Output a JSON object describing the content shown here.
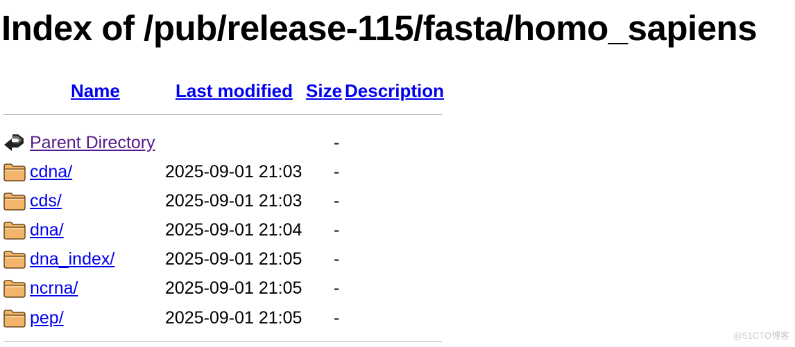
{
  "page": {
    "title": "Index of /pub/release-115/fasta/homo_sapiens"
  },
  "table": {
    "headers": {
      "name": "Name",
      "last_modified": "Last modified",
      "size": "Size",
      "description": "Description"
    },
    "parent": {
      "name": "Parent Directory",
      "size": "-",
      "icon": "back-arrow-icon"
    },
    "rows": [
      {
        "name": "cdna/",
        "last_modified": "2025-09-01 21:03",
        "size": "-",
        "icon": "folder-icon"
      },
      {
        "name": "cds/",
        "last_modified": "2025-09-01 21:03",
        "size": "-",
        "icon": "folder-icon"
      },
      {
        "name": "dna/",
        "last_modified": "2025-09-01 21:04",
        "size": "-",
        "icon": "folder-icon"
      },
      {
        "name": "dna_index/",
        "last_modified": "2025-09-01 21:05",
        "size": "-",
        "icon": "folder-icon"
      },
      {
        "name": "ncrna/",
        "last_modified": "2025-09-01 21:05",
        "size": "-",
        "icon": "folder-icon"
      },
      {
        "name": "pep/",
        "last_modified": "2025-09-01 21:05",
        "size": "-",
        "icon": "folder-icon"
      }
    ]
  },
  "watermark": "@51CTO博客",
  "colors": {
    "link": "#0000ee",
    "visited_link": "#551a8b",
    "rule": "#b0b0b0",
    "folder_fill": "#f2b56b",
    "folder_stroke": "#6b4a1f"
  }
}
